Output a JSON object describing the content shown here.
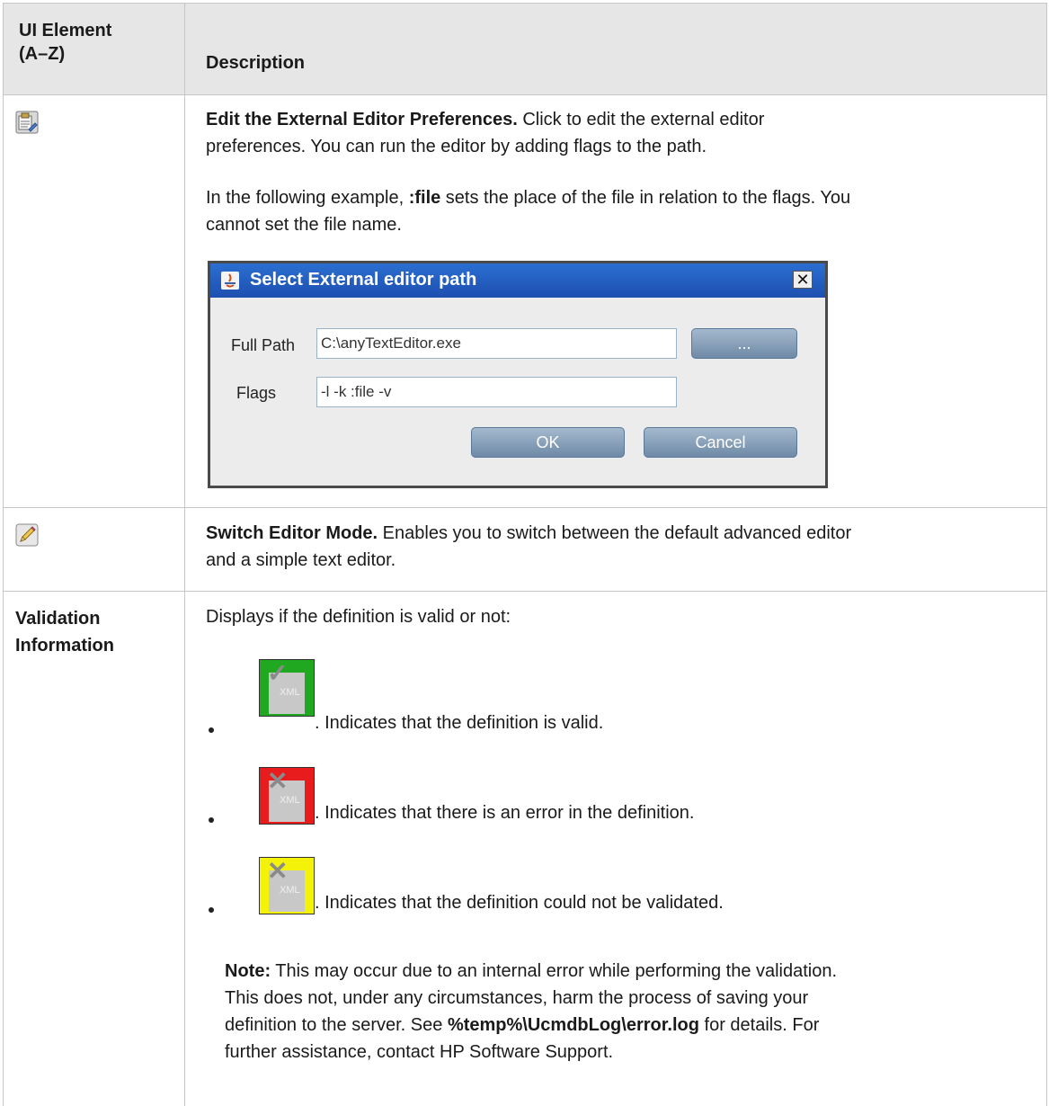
{
  "header": {
    "col1_line1": "UI Element",
    "col1_line2": "(A–Z)",
    "col2": "Description"
  },
  "row1": {
    "icon": "preferences-icon",
    "title": "Edit the External Editor Preferences.",
    "text_line1_rest": " Click to edit the external editor",
    "text_line2": "preferences. You can run the editor by adding flags to the path.",
    "para2_pre": "In the following example, ",
    "para2_bold": ":file",
    "para2_post": " sets the place of the file in relation to the flags. You",
    "para2_line2": "cannot set the file name.",
    "dialog": {
      "title": "Select External editor path",
      "close": "✕",
      "full_path_label": "Full Path",
      "full_path_value": "C:\\anyTextEditor.exe",
      "browse_label": "...",
      "flags_label": "Flags",
      "flags_value": "-l -k :file -v",
      "ok_label": "OK",
      "cancel_label": "Cancel"
    }
  },
  "row2": {
    "icon": "pencil-icon",
    "title": "Switch Editor Mode.",
    "text_line1_rest": " Enables you to switch between the default advanced editor",
    "text_line2": "and a simple text editor."
  },
  "row3": {
    "label_line1": "Validation",
    "label_line2": "Information",
    "intro": "Displays if the definition is valid or not:",
    "items": [
      {
        "icon": "xml-valid-icon",
        "color": "#21a821",
        "mark": "✓",
        "xml": "XML",
        "text": ". Indicates that the definition is valid."
      },
      {
        "icon": "xml-error-icon",
        "color": "#e81c1c",
        "mark": "✕",
        "xml": "XML",
        "text": ". Indicates that there is an error in the definition."
      },
      {
        "icon": "xml-unvalidated-icon",
        "color": "#f5f20a",
        "mark": "✕",
        "xml": "XML",
        "text": ". Indicates that the definition could not be validated."
      }
    ],
    "note_label": "Note:",
    "note_line1_rest": " This may occur due to an internal error while performing the validation.",
    "note_line2": "This does not, under any circumstances, harm the process of saving your",
    "note_line3_pre": "definition to the server. See ",
    "note_line3_bold": "%temp%\\UcmdbLog\\error.log",
    "note_line3_post": " for details. For",
    "note_line4": "further assistance, contact HP Software Support."
  }
}
